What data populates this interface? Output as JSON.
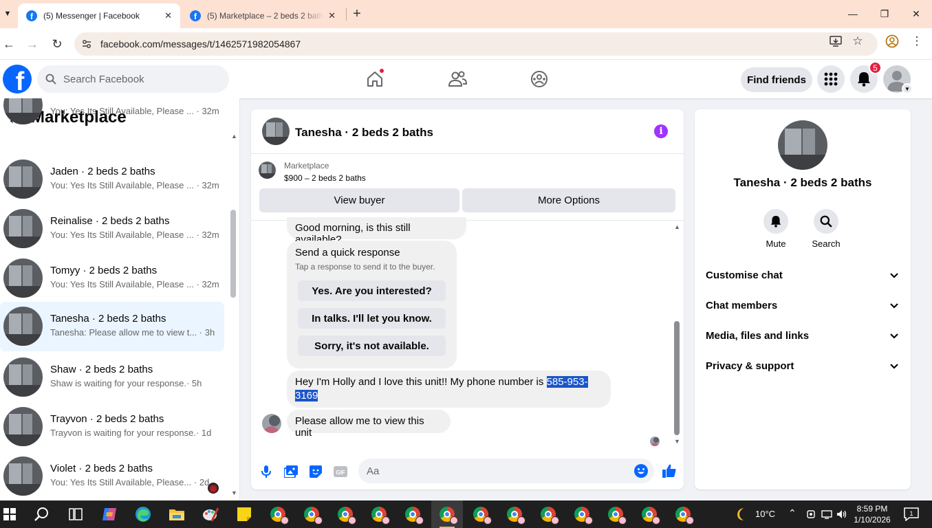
{
  "browser": {
    "tabs": [
      {
        "title": "(5) Messenger | Facebook",
        "active": true
      },
      {
        "title": "(5) Marketplace – 2 beds 2 baths",
        "active": false
      }
    ],
    "url": "facebook.com/messages/t/1462571982054867"
  },
  "header": {
    "search_placeholder": "Search Facebook",
    "find_friends": "Find friends",
    "notification_count": "5"
  },
  "left": {
    "title": "Marketplace",
    "conversations": [
      {
        "name": "",
        "preview": "You: Yes Its Still Available, Please ...",
        "time": "· 32m"
      },
      {
        "name": "Jaden · 2 beds 2 baths",
        "preview": "You: Yes Its Still Available, Please ...",
        "time": "· 32m"
      },
      {
        "name": "Reinalise · 2 beds 2 baths",
        "preview": "You: Yes Its Still Available, Please ...",
        "time": "· 32m"
      },
      {
        "name": "Tomyy · 2 beds 2 baths",
        "preview": "You: Yes Its Still Available, Please ...",
        "time": "· 32m"
      },
      {
        "name": "Tanesha · 2 beds 2 baths",
        "preview": "Tanesha: Please allow me to view t...",
        "time": "· 3h",
        "active": true
      },
      {
        "name": "Shaw · 2 beds 2 baths",
        "preview": "Shaw is waiting for your response.",
        "time": "· 5h"
      },
      {
        "name": "Trayvon · 2 beds 2 baths",
        "preview": "Trayvon is waiting for your response.",
        "time": "· 1d"
      },
      {
        "name": "Violet · 2 beds 2 baths",
        "preview": "You: Yes Its Still Available, Please...",
        "time": "· 2d"
      }
    ]
  },
  "chat": {
    "title": "Tanesha · 2 beds 2 baths",
    "listing_source": "Marketplace",
    "listing_price": "$900 – 2 beds 2 baths",
    "view_buyer": "View buyer",
    "more_options": "More Options",
    "messages": {
      "first": "Good morning, is this still available?",
      "quick_title": "Send a quick response",
      "quick_sub": "Tap a response to send it to the buyer.",
      "quick_options": [
        "Yes. Are you interested?",
        "In talks. I'll let you know.",
        "Sorry, it's not available."
      ],
      "holly_prefix": "Hey I'm Holly and I love this unit!! My phone number is ",
      "phone_part1": "585-953-",
      "phone_part2": "3169",
      "last": "Please allow me to view this unit"
    },
    "composer_placeholder": "Aa"
  },
  "right": {
    "name": "Tanesha · 2 beds 2 baths",
    "mute": "Mute",
    "search": "Search",
    "sections": [
      "Customise chat",
      "Chat members",
      "Media, files and links",
      "Privacy & support"
    ]
  },
  "taskbar": {
    "weather": "10°C",
    "time": "8:59 PM",
    "date": "1/10/2026",
    "notifications": "1"
  },
  "colors": {
    "facebook_blue": "#0866ff",
    "messenger_purple": "#a033ff",
    "notification_red": "#e41e3f",
    "active_conversation": "#ebf5ff",
    "selection": "#1a55c9"
  }
}
